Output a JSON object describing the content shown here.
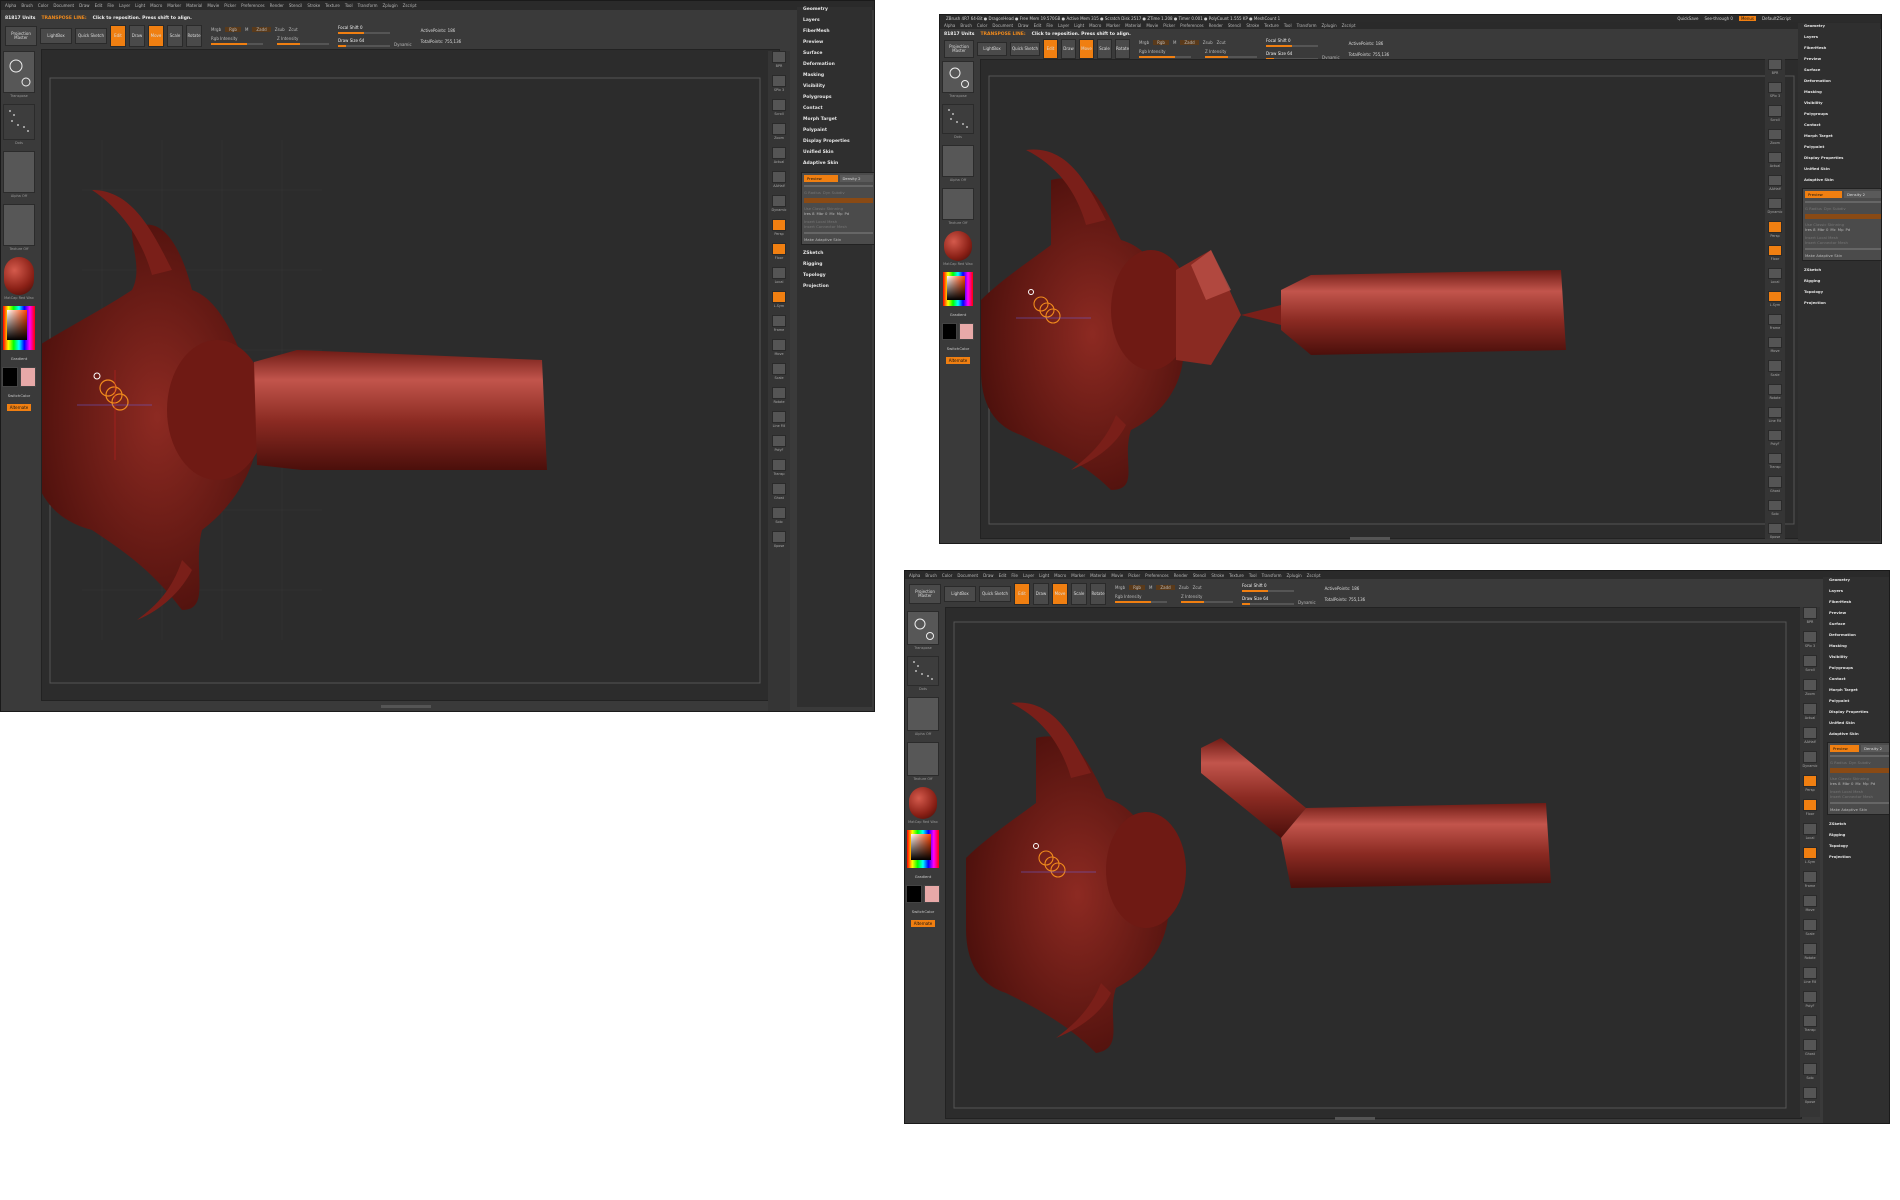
{
  "menu": [
    "Alpha",
    "Brush",
    "Color",
    "Document",
    "Draw",
    "Edit",
    "File",
    "Layer",
    "Light",
    "Macro",
    "Marker",
    "Material",
    "Movie",
    "Picker",
    "Preferences",
    "Render",
    "Stencil",
    "Stroke",
    "Texture",
    "Tool",
    "Transform",
    "Zplugin",
    "Zscript"
  ],
  "title_bar": "ZBrush 4R7 64-Bit ● DragonHead ● Free Mem 19.570GB ● Active Mem 315 ● Scratch Disk 2517 ● ZTime 1.208 ● Timer 0.001 ● PolyCount 1.555 KP ● MeshCount 1",
  "title_right": [
    "QuickSave",
    "See-through 0",
    "Menus",
    "DefaultZScript"
  ],
  "info": {
    "count": "81817 Units",
    "hint_mode": "TRANSPOSE LINE:",
    "hint_text": "Click to reposition. Press shift to align."
  },
  "toolbar": {
    "projection_master": "Projection Master",
    "lightbox": "LightBox",
    "quick_sketch": "Quick Sketch",
    "edit": "Edit",
    "draw": "Draw",
    "move": "Move",
    "scale": "Scale",
    "rotate": "Rotate",
    "mrgb": "Mrgb",
    "rgb": "Rgb",
    "m": "M",
    "zadd": "Zadd",
    "zsub": "Zsub",
    "zcut": "Zcut",
    "rgb_intensity": "Rgb Intensity",
    "z_intensity": "Z Intensity",
    "focal_shift": "Focal Shift 0",
    "draw_size": "Draw Size 64",
    "dynamic": "Dynamic",
    "active_points": "ActivePoints: 186",
    "total_points": "TotalPoints: 755,136"
  },
  "left_shelf": {
    "brush_label": "Transpose",
    "stroke_label": "Dots",
    "alpha_label": "Alpha Off",
    "texture_label": "Texture Off",
    "material_label": "MatCap Red Wax",
    "gradient_label": "Gradient",
    "switch_color_label": "SwitchColor",
    "alternate_label": "Alternate"
  },
  "right_strip": [
    "BPR",
    "SPix 3",
    "Scroll",
    "Zoom",
    "Actual",
    "AAHalf",
    "Dynamic",
    "Persp",
    "Floor",
    "Local",
    "L.Sym",
    "Frame",
    "Move",
    "Scale",
    "Rotate",
    "Line Fill",
    "PolyF",
    "Transp",
    "Ghost",
    "Solo",
    "Xpose"
  ],
  "tool_palette": {
    "items_top": [
      "Geometry",
      "Layers",
      "FiberMesh",
      "Preview",
      "Surface",
      "Deformation",
      "Masking",
      "Visibility",
      "Polygroups",
      "Contact",
      "Morph Target",
      "Polypaint",
      "Display Properties",
      "Unified Skin"
    ],
    "adaptive_skin": "Adaptive Skin",
    "adaptive": {
      "preview": "Preview",
      "density": "Density 2",
      "g_radius": "G Radius",
      "dyn_res": "Dyn Subdiv",
      "use_classic": "Use Classic Skinning",
      "ires": "Ires 8",
      "mbr": "Mbr 0",
      "mc": "Mc",
      "mp": "Mp",
      "pd": "Pd",
      "insert_local": "Insert Local Mesh",
      "insert_connector": "Insert Connector Mesh",
      "make_adaptive": "Make Adaptive Skin"
    },
    "items_bottom": [
      "ZSketch",
      "Rigging",
      "Topology",
      "Projection"
    ]
  },
  "colors": {
    "accent": "#f07f11",
    "model": "#7a1f19",
    "model_highlight": "#c2554c",
    "ui_dark": "#3a3a3a",
    "viewport": "#2c2c2c"
  }
}
